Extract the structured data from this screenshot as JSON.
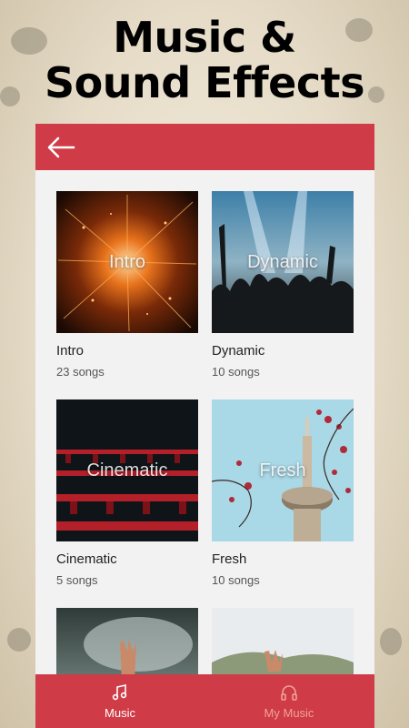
{
  "promo": {
    "headline_line1": "Music &",
    "headline_line2": "Sound Effects"
  },
  "app_bar": {
    "back_icon": "arrow-left-icon",
    "color": "#cf3b47"
  },
  "categories": [
    {
      "title": "Intro",
      "overlay": "Intro",
      "count": "23 songs"
    },
    {
      "title": "Dynamic",
      "overlay": "Dynamic",
      "count": "10 songs"
    },
    {
      "title": "Cinematic",
      "overlay": "Cinematic",
      "count": "5 songs"
    },
    {
      "title": "Fresh",
      "overlay": "Fresh",
      "count": "10 songs"
    },
    {
      "title": "",
      "overlay": "",
      "count": ""
    },
    {
      "title": "",
      "overlay": "",
      "count": ""
    }
  ],
  "bottom_nav": {
    "items": [
      {
        "label": "Music",
        "icon": "music-note-icon",
        "active": true
      },
      {
        "label": "My Music",
        "icon": "headphones-icon",
        "active": false
      }
    ],
    "active_color": "#ffffff",
    "inactive_color": "#f2a19b"
  }
}
